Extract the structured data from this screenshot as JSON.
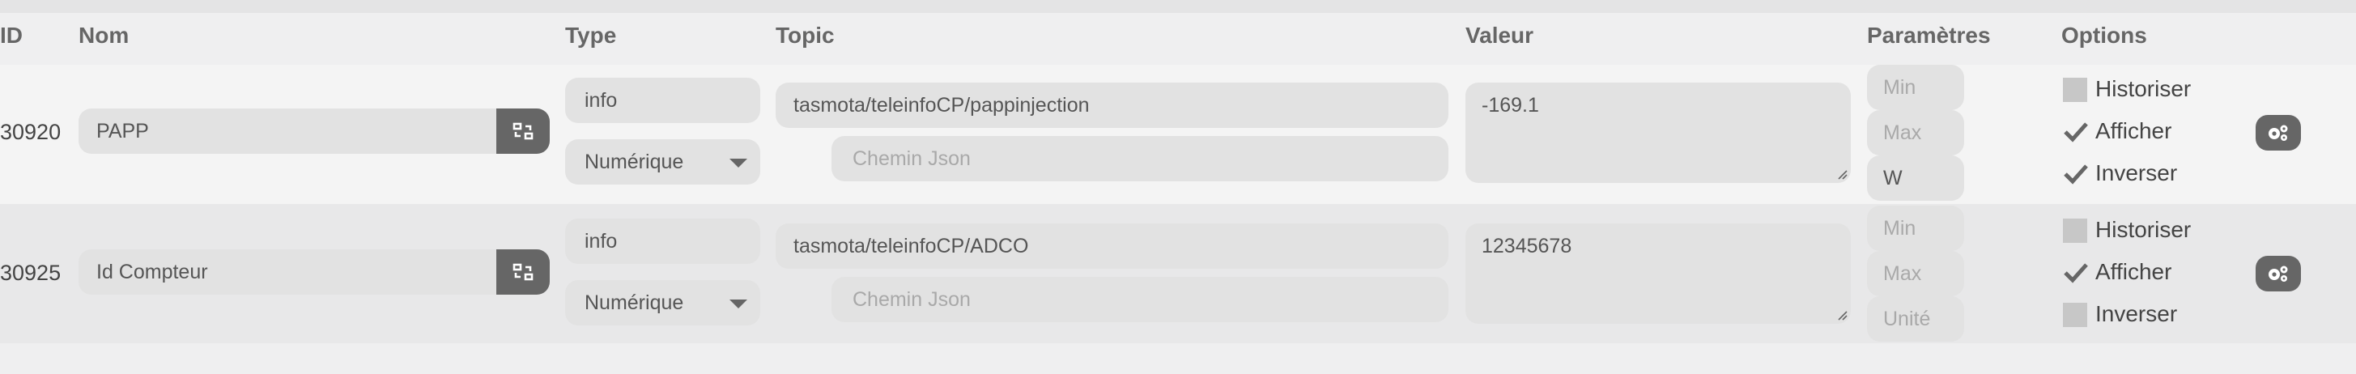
{
  "headers": {
    "id": "ID",
    "name": "Nom",
    "type": "Type",
    "topic": "Topic",
    "value": "Valeur",
    "params": "Paramètres",
    "options": "Options"
  },
  "rows": [
    {
      "id": "30920",
      "name": "PAPP",
      "type": "info",
      "subtype": "Numérique",
      "topic": "tasmota/teleinfoCP/pappinjection",
      "json_path_placeholder": "Chemin Json",
      "value": "-169.1",
      "min_placeholder": "Min",
      "max_placeholder": "Max",
      "unit_value": "W",
      "unit_placeholder": "",
      "options": {
        "historize_label": "Historiser",
        "historize": false,
        "display_label": "Afficher",
        "display": true,
        "invert_label": "Inverser",
        "invert": true
      }
    },
    {
      "id": "30925",
      "name": "Id Compteur",
      "type": "info",
      "subtype": "Numérique",
      "topic": "tasmota/teleinfoCP/ADCO",
      "json_path_placeholder": "Chemin Json",
      "value": "12345678",
      "min_placeholder": "Min",
      "max_placeholder": "Max",
      "unit_value": "",
      "unit_placeholder": "Unité",
      "options": {
        "historize_label": "Historiser",
        "historize": false,
        "display_label": "Afficher",
        "display": true,
        "invert_label": "Inverser",
        "invert": false
      }
    }
  ],
  "icons": {
    "name_button": "swap-icon",
    "config_button": "gears-icon",
    "check": "check-icon"
  }
}
